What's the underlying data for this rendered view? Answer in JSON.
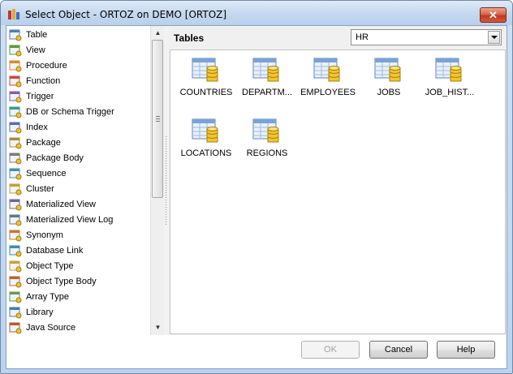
{
  "window": {
    "title": "Select Object - ORTOZ on DEMO [ORTOZ]",
    "close_label": "x"
  },
  "object_types": [
    {
      "label": "Table",
      "icon": "table-icon"
    },
    {
      "label": "View",
      "icon": "view-icon"
    },
    {
      "label": "Procedure",
      "icon": "procedure-icon"
    },
    {
      "label": "Function",
      "icon": "function-icon"
    },
    {
      "label": "Trigger",
      "icon": "trigger-icon"
    },
    {
      "label": "DB or Schema Trigger",
      "icon": "db-trigger-icon"
    },
    {
      "label": "Index",
      "icon": "index-icon"
    },
    {
      "label": "Package",
      "icon": "package-icon"
    },
    {
      "label": "Package Body",
      "icon": "package-body-icon"
    },
    {
      "label": "Sequence",
      "icon": "sequence-icon"
    },
    {
      "label": "Cluster",
      "icon": "cluster-icon"
    },
    {
      "label": "Materialized View",
      "icon": "materialized-view-icon"
    },
    {
      "label": "Materialized View Log",
      "icon": "materialized-view-log-icon"
    },
    {
      "label": "Synonym",
      "icon": "synonym-icon"
    },
    {
      "label": "Database Link",
      "icon": "database-link-icon"
    },
    {
      "label": "Object Type",
      "icon": "object-type-icon"
    },
    {
      "label": "Object Type Body",
      "icon": "object-type-body-icon"
    },
    {
      "label": "Array Type",
      "icon": "array-type-icon"
    },
    {
      "label": "Library",
      "icon": "library-icon"
    },
    {
      "label": "Java Source",
      "icon": "java-source-icon"
    }
  ],
  "panel": {
    "title": "Tables",
    "schema_value": "HR"
  },
  "tables": [
    {
      "label": "COUNTRIES"
    },
    {
      "label": "DEPARTM..."
    },
    {
      "label": "EMPLOYEES"
    },
    {
      "label": "JOBS"
    },
    {
      "label": "JOB_HIST..."
    },
    {
      "label": "LOCATIONS"
    },
    {
      "label": "REGIONS"
    }
  ],
  "buttons": {
    "ok": "OK",
    "cancel": "Cancel",
    "help": "Help"
  }
}
